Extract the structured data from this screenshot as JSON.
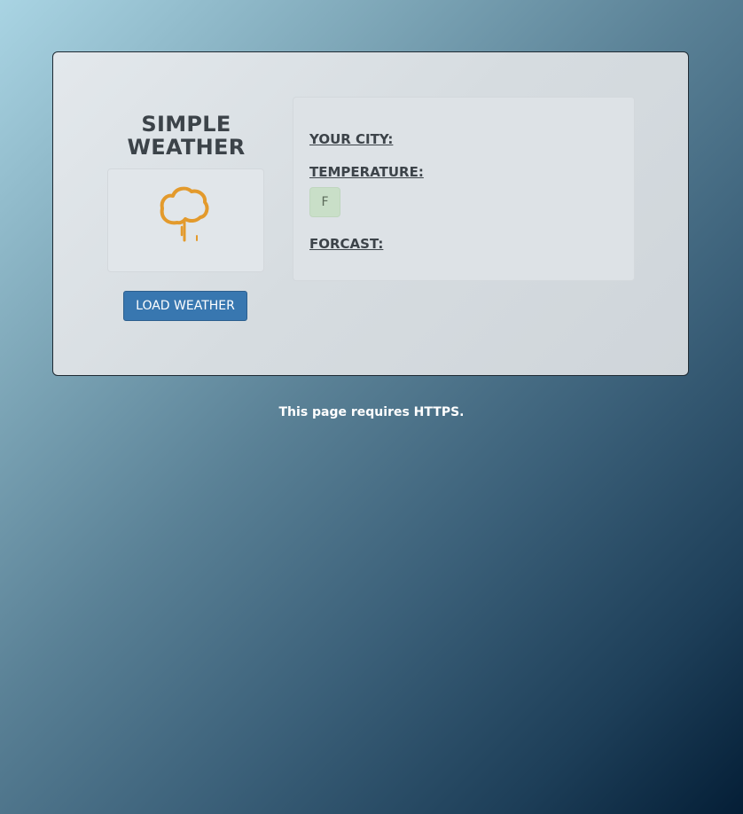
{
  "app": {
    "title": "SIMPLE WEATHER"
  },
  "weather_icon": {
    "icon": "cloud-drizzle-icon",
    "color": "#e39a2c"
  },
  "buttons": {
    "load_weather": "LOAD WEATHER"
  },
  "info": {
    "city_label": "YOUR CITY:",
    "temperature_label": "TEMPERATURE:",
    "temperature_unit": "F",
    "forecast_label": "FORCAST:"
  },
  "footer": {
    "https_note": "This page requires HTTPS."
  },
  "colors": {
    "button_bg": "#3877b0",
    "unit_badge_bg": "#c9dfc8",
    "heading_text": "#3c4349"
  }
}
